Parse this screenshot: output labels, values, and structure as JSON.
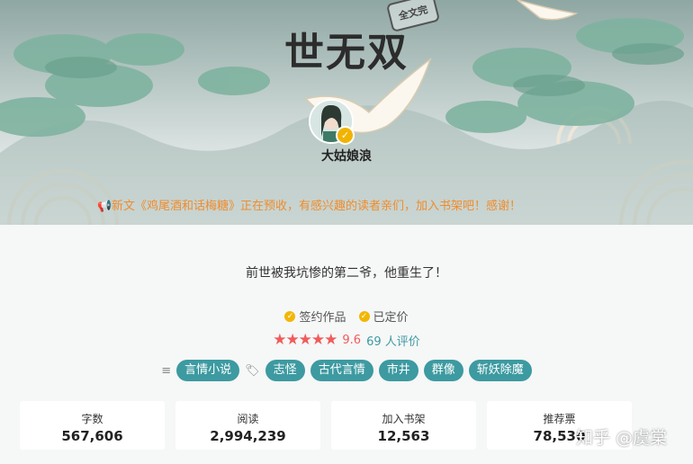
{
  "book": {
    "title": "世无双",
    "stamp": "全文完",
    "author": "大姑娘浪",
    "notice": "新文《鸡尾酒和话梅糖》正在预收，有感兴趣的读者亲们，加入书架吧！感谢！",
    "intro": "前世被我坑惨的第二爷，他重生了！",
    "badges": [
      "签约作品",
      "已定价"
    ],
    "rating": {
      "stars": 5,
      "score": "9.6",
      "reviews": "69 人评价"
    },
    "tags": [
      "言情小说",
      "志怪",
      "古代言情",
      "市井",
      "群像",
      "斩妖除魔"
    ],
    "stats": [
      {
        "label": "字数",
        "value": "567,606"
      },
      {
        "label": "阅读",
        "value": "2,994,239"
      },
      {
        "label": "加入书架",
        "value": "12,563"
      },
      {
        "label": "推荐票",
        "value": "78,530"
      }
    ]
  },
  "watermark": "知乎 @虞棠",
  "icons": {
    "notice": "megaphone-icon",
    "badge": "checkmark-circle-icon",
    "rating": "star-icon",
    "menu": "list-icon",
    "tag": "tag-icon",
    "verified": "verified-icon"
  },
  "colors": {
    "accent": "#3d9aa1",
    "notice": "#f08c2c",
    "rating": "#f05b5b",
    "badge": "#f2b705"
  }
}
